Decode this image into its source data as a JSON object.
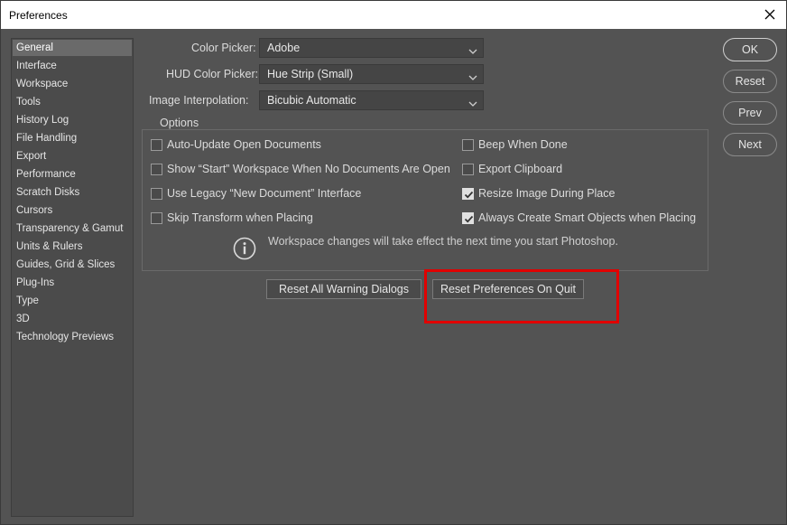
{
  "window": {
    "title": "Preferences"
  },
  "sidebar": {
    "items": [
      {
        "label": "General",
        "active": true
      },
      {
        "label": "Interface"
      },
      {
        "label": "Workspace"
      },
      {
        "label": "Tools"
      },
      {
        "label": "History Log"
      },
      {
        "label": "File Handling"
      },
      {
        "label": "Export"
      },
      {
        "label": "Performance"
      },
      {
        "label": "Scratch Disks"
      },
      {
        "label": "Cursors"
      },
      {
        "label": "Transparency & Gamut"
      },
      {
        "label": "Units & Rulers"
      },
      {
        "label": "Guides, Grid & Slices"
      },
      {
        "label": "Plug-Ins"
      },
      {
        "label": "Type"
      },
      {
        "label": "3D"
      },
      {
        "label": "Technology Previews"
      }
    ]
  },
  "pickers": {
    "color_picker": {
      "label": "Color Picker:",
      "value": "Adobe"
    },
    "hud_color_picker": {
      "label": "HUD Color Picker:",
      "value": "Hue Strip (Small)"
    },
    "image_interpolation": {
      "label": "Image Interpolation:",
      "value": "Bicubic Automatic"
    }
  },
  "options": {
    "title": "Options",
    "left": [
      {
        "label": "Auto-Update Open Documents",
        "checked": false
      },
      {
        "label": "Show “Start” Workspace When No Documents Are Open",
        "checked": false
      },
      {
        "label": "Use Legacy “New Document” Interface",
        "checked": false
      },
      {
        "label": "Skip Transform when Placing",
        "checked": false
      }
    ],
    "right": [
      {
        "label": "Beep When Done",
        "checked": false
      },
      {
        "label": "Export Clipboard",
        "checked": false
      },
      {
        "label": "Resize Image During Place",
        "checked": true
      },
      {
        "label": "Always Create Smart Objects when Placing",
        "checked": true
      }
    ],
    "info": "Workspace changes will take effect the next time you start Photoshop."
  },
  "buttons": {
    "reset_warnings": "Reset All Warning Dialogs",
    "reset_prefs": "Reset Preferences On Quit",
    "ok": "OK",
    "reset": "Reset",
    "prev": "Prev",
    "next": "Next"
  },
  "colors": {
    "highlight": "#e10000",
    "panel": "#535353"
  }
}
